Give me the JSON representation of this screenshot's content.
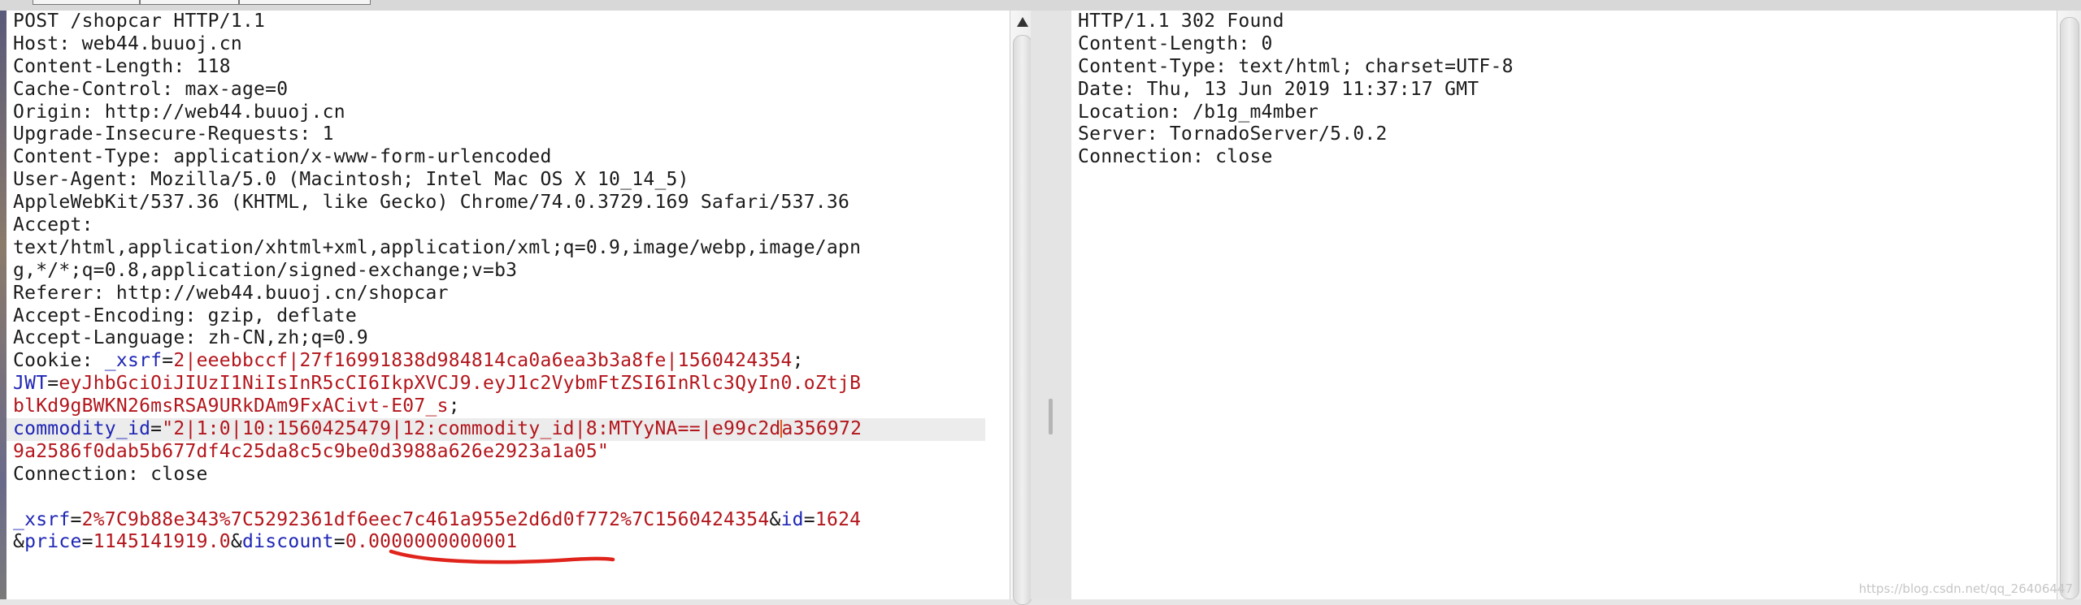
{
  "request": {
    "lines": [
      [
        {
          "t": "POST /shopcar HTTP/1.1"
        }
      ],
      [
        {
          "t": "Host: web44.buuoj.cn"
        }
      ],
      [
        {
          "t": "Content-Length: 118"
        }
      ],
      [
        {
          "t": "Cache-Control: max-age=0"
        }
      ],
      [
        {
          "t": "Origin: http://web44.buuoj.cn"
        }
      ],
      [
        {
          "t": "Upgrade-Insecure-Requests: 1"
        }
      ],
      [
        {
          "t": "Content-Type: application/x-www-form-urlencoded"
        }
      ],
      [
        {
          "t": "User-Agent: Mozilla/5.0 (Macintosh; Intel Mac OS X 10_14_5)"
        }
      ],
      [
        {
          "t": "AppleWebKit/537.36 (KHTML, like Gecko) Chrome/74.0.3729.169 Safari/537.36"
        }
      ],
      [
        {
          "t": "Accept:"
        }
      ],
      [
        {
          "t": "text/html,application/xhtml+xml,application/xml;q=0.9,image/webp,image/apn"
        }
      ],
      [
        {
          "t": "g,*/*;q=0.8,application/signed-exchange;v=b3"
        }
      ],
      [
        {
          "t": "Referer: http://web44.buuoj.cn/shopcar"
        }
      ],
      [
        {
          "t": "Accept-Encoding: gzip, deflate"
        }
      ],
      [
        {
          "t": "Accept-Language: zh-CN,zh;q=0.9"
        }
      ],
      [
        {
          "t": "Cookie: "
        },
        {
          "t": "_xsrf",
          "c": "k"
        },
        {
          "t": "="
        },
        {
          "t": "2|eeebbccf|27f16991838d984814ca0a6ea3b3a8fe|1560424354",
          "c": "v"
        },
        {
          "t": ";"
        }
      ],
      [
        {
          "t": "JWT",
          "c": "k"
        },
        {
          "t": "="
        },
        {
          "t": "eyJhbGciOiJIUzI1NiIsInR5cCI6IkpXVCJ9.eyJ1c2VybmFtZSI6InRlc3QyIn0.oZtjB",
          "c": "v"
        }
      ],
      [
        {
          "t": "blKd9gBWKN26msRSA9URkDAm9FxACivt-E07_s",
          "c": "v"
        },
        {
          "t": ";"
        }
      ],
      [
        {
          "t": "commodity_id",
          "c": "k"
        },
        {
          "t": "="
        },
        {
          "t": "\"2|1:0|10:1560425479|12:commodity_id|8:MTYyNA==|e99c2d",
          "c": "v"
        },
        {
          "t": "",
          "c": "caret"
        },
        {
          "t": "a356972",
          "c": "v"
        }
      ],
      [
        {
          "t": "9a2586f0dab5b677df4c25da8c5c9be0d3988a626e2923a1a05\"",
          "c": "v"
        }
      ],
      [
        {
          "t": "Connection: close"
        }
      ],
      [
        {
          "t": ""
        }
      ],
      [
        {
          "t": "_xsrf",
          "c": "k"
        },
        {
          "t": "="
        },
        {
          "t": "2%7C9b88e343%7C5292361df6eec7c461a955e2d6d0f772%7C1560424354",
          "c": "v"
        },
        {
          "t": "&"
        },
        {
          "t": "id",
          "c": "k"
        },
        {
          "t": "="
        },
        {
          "t": "1624",
          "c": "v"
        }
      ],
      [
        {
          "t": "&"
        },
        {
          "t": "price",
          "c": "k"
        },
        {
          "t": "="
        },
        {
          "t": "1145141919.0",
          "c": "v"
        },
        {
          "t": "&"
        },
        {
          "t": "discount",
          "c": "k"
        },
        {
          "t": "="
        },
        {
          "t": "0.0000000000001",
          "c": "v"
        }
      ]
    ]
  },
  "response": {
    "lines": [
      "HTTP/1.1 302 Found",
      "Content-Length: 0",
      "Content-Type: text/html; charset=UTF-8",
      "Date: Thu, 13 Jun 2019 11:37:17 GMT",
      "Location: /b1g_m4mber",
      "Server: TornadoServer/5.0.2",
      "Connection: close"
    ]
  },
  "colors": {
    "param_name": "#1f26b4",
    "param_value": "#b3161c",
    "annotation_underline": "#e0241c",
    "caret": "#e05a1a"
  },
  "icons": [
    "scroll-up-arrow-icon"
  ],
  "watermark": "https://blog.csdn.net/qq_26406447"
}
